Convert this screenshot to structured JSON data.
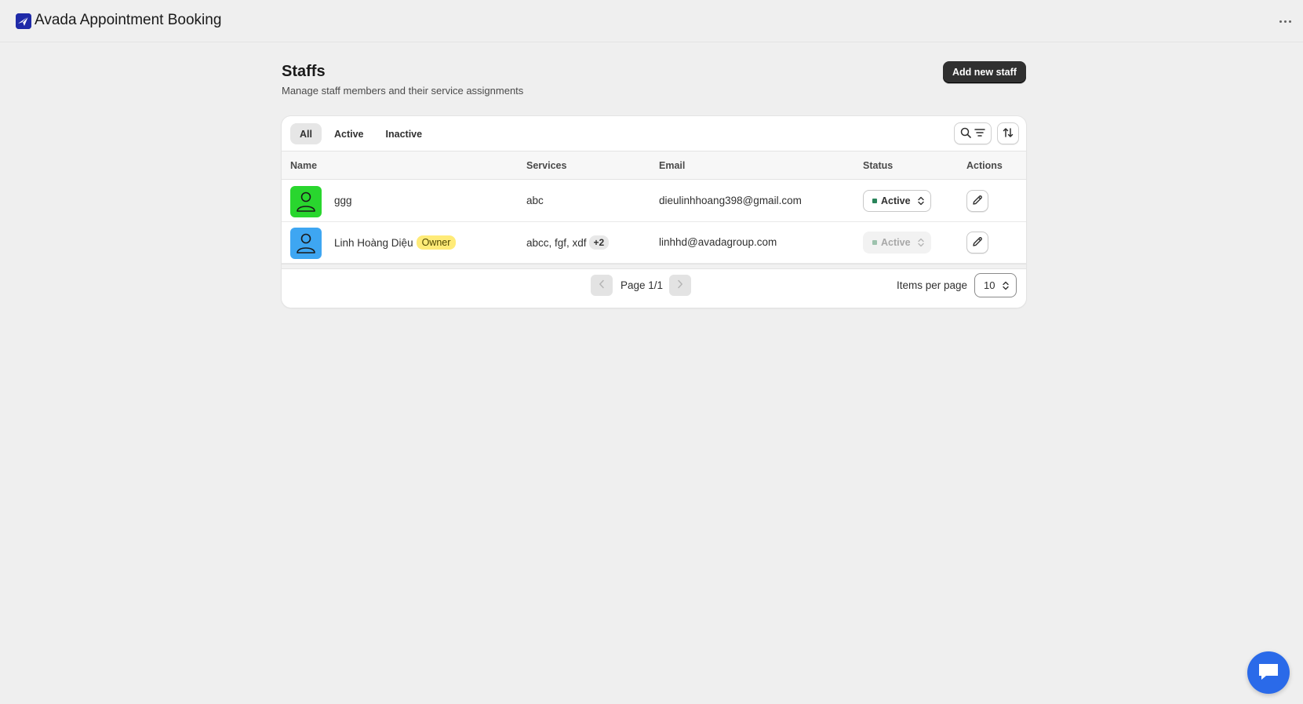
{
  "app": {
    "title": "Avada Appointment Booking",
    "logo_icon": "avada-logo-icon",
    "more_icon": "more-horizontal-icon"
  },
  "page": {
    "title": "Staffs",
    "subtitle": "Manage staff members and their service assignments",
    "primary_action": "Add new staff"
  },
  "tabs": [
    {
      "label": "All",
      "selected": true
    },
    {
      "label": "Active",
      "selected": false
    },
    {
      "label": "Inactive",
      "selected": false
    }
  ],
  "toolbar": {
    "search_icon": "search-icon",
    "filter_icon": "filter-icon",
    "sort_icon": "sort-icon"
  },
  "table": {
    "headers": {
      "name": "Name",
      "services": "Services",
      "email": "Email",
      "status": "Status",
      "actions": "Actions"
    },
    "rows": [
      {
        "name": "ggg",
        "badge": "",
        "avatar_color": "#29d62e",
        "services": "abc",
        "services_more": "",
        "email": "dieulinhhoang398@gmail.com",
        "status": "Active",
        "status_disabled": false
      },
      {
        "name": "Linh Hoàng Diệu",
        "badge": "Owner",
        "avatar_color": "#3ea6f2",
        "services": "abcc, fgf, xdf",
        "services_more": "+2",
        "email": "linhhd@avadagroup.com",
        "status": "Active",
        "status_disabled": true
      }
    ]
  },
  "pagination": {
    "page_label": "Page 1/1",
    "items_per_page_label": "Items per page",
    "items_per_page": "10"
  },
  "colors": {
    "primary_button": "#303030",
    "status_active": "#29845a",
    "owner_badge": "#ffeb78",
    "chat": "#2a6ae9"
  }
}
